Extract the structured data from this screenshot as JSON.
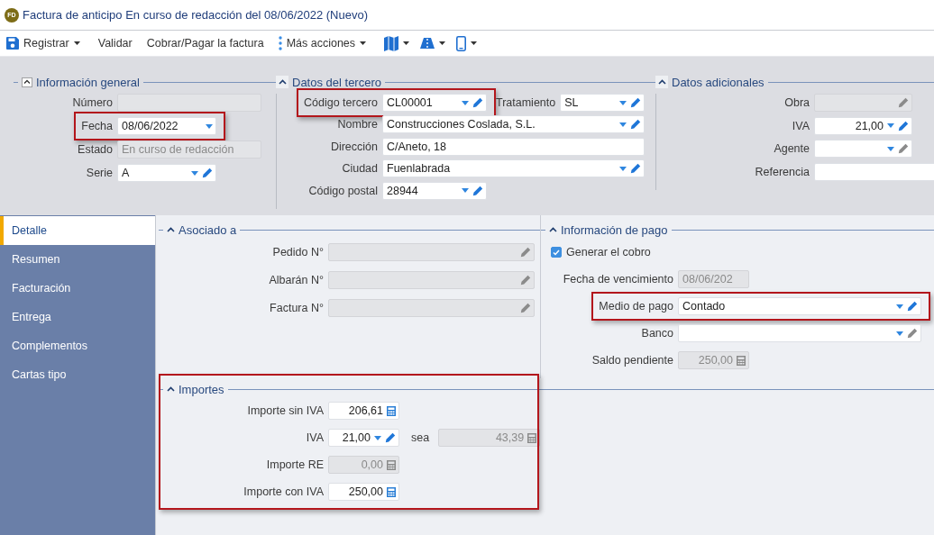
{
  "window": {
    "badge": "FD",
    "title": "Factura de anticipo En curso de redacción del 08/06/2022 (Nuevo)"
  },
  "toolbar": [
    {
      "kind": "save",
      "label": "Registrar",
      "menu": true
    },
    {
      "kind": "plain",
      "label": "Validar",
      "menu": false
    },
    {
      "kind": "plain",
      "label": "Cobrar/Pagar la factura",
      "menu": false
    },
    {
      "kind": "more",
      "label": "Más acciones",
      "menu": true
    },
    {
      "kind": "map",
      "menu": true
    },
    {
      "kind": "road",
      "menu": true
    },
    {
      "kind": "phone",
      "menu": true
    }
  ],
  "header_sections": [
    {
      "title": "Información general",
      "kind": "box",
      "fields": [
        {
          "label": "Número",
          "kind": "text",
          "disabled": true,
          "highlighted": false
        },
        {
          "label": "Fecha",
          "value": "08/06/2022",
          "kind": "date",
          "disabled": false,
          "highlighted": true
        },
        {
          "label": "Estado",
          "value": "En curso de redacción",
          "kind": "text",
          "disabled": true,
          "highlighted": false
        },
        {
          "label": "Serie",
          "value": "A",
          "kind": "lookup",
          "disabled": false,
          "highlighted": false,
          "edit": true
        }
      ]
    },
    {
      "title": "Datos del tercero",
      "kind": "caret",
      "fields": [
        {
          "label": "Código tercero",
          "value": "CL00001",
          "kind": "lookup",
          "disabled": false,
          "highlighted": true,
          "edit": true,
          "extra": {
            "label": "Tratamiento",
            "value": "SL",
            "kind": "lookup",
            "disabled": false,
            "edit": true
          }
        },
        {
          "label": "Nombre",
          "value": "Construcciones Coslada, S.L.",
          "kind": "lookup",
          "disabled": false,
          "highlighted": false,
          "edit": true
        },
        {
          "label": "Dirección",
          "value": "C/Aneto, 18",
          "kind": "text",
          "disabled": false,
          "highlighted": false
        },
        {
          "label": "Ciudad",
          "value": "Fuenlabrada",
          "kind": "lookup",
          "disabled": false,
          "highlighted": false,
          "edit": true
        },
        {
          "label": "Código postal",
          "value": "28944",
          "kind": "lookup",
          "disabled": false,
          "highlighted": false,
          "edit": true
        }
      ]
    },
    {
      "title": "Datos adicionales",
      "kind": "caret",
      "fields": [
        {
          "label": "Obra",
          "kind": "link",
          "disabled": true,
          "highlighted": false
        },
        {
          "label": "IVA",
          "value": "21,00",
          "kind": "lookup",
          "numeric": true,
          "disabled": false,
          "highlighted": false,
          "edit": true
        },
        {
          "label": "Agente",
          "kind": "lookup",
          "disabled": false,
          "highlighted": false,
          "edit": false
        },
        {
          "label": "Referencia",
          "kind": "text",
          "disabled": false,
          "highlighted": false
        }
      ]
    }
  ],
  "tabs": [
    {
      "label": "Detalle",
      "selected": true
    },
    {
      "label": "Resumen",
      "selected": false
    },
    {
      "label": "Facturación",
      "selected": false
    },
    {
      "label": "Entrega",
      "selected": false
    },
    {
      "label": "Complementos",
      "selected": false
    },
    {
      "label": "Cartas tipo",
      "selected": false
    }
  ],
  "detail_sections": [
    {
      "title": "Asociado a",
      "kind": "caret",
      "fields": [
        {
          "label": "Pedido N°",
          "kind": "link",
          "disabled": true,
          "highlighted": false
        },
        {
          "label": "Albarán N°",
          "kind": "link",
          "disabled": true,
          "highlighted": false
        },
        {
          "label": "Factura N°",
          "kind": "link",
          "disabled": true,
          "highlighted": false
        }
      ]
    },
    {
      "title": "Información de pago",
      "kind": "caret",
      "fields": [
        {
          "label": "Generar el cobro",
          "kind": "checkbox",
          "checked": true
        },
        {
          "label": "Fecha de vencimiento",
          "value": "08/06/202",
          "kind": "text",
          "disabled": true,
          "highlighted": false
        },
        {
          "label": "Medio de pago",
          "value": "Contado",
          "kind": "lookup",
          "disabled": false,
          "highlighted": true,
          "edit": true
        },
        {
          "label": "Banco",
          "kind": "lookup",
          "disabled": false,
          "highlighted": false,
          "edit": false
        },
        {
          "label": "Saldo pendiente",
          "value": "250,00",
          "kind": "amount",
          "disabled": true,
          "highlighted": false
        }
      ]
    }
  ],
  "amounts": {
    "title": "Importes",
    "kind": "caret",
    "highlighted": true,
    "fields": [
      {
        "label": "Importe sin IVA",
        "value": "206,61",
        "kind": "amount",
        "disabled": false,
        "highlighted": false
      },
      {
        "label": "IVA",
        "value": "21,00",
        "kind": "lookup",
        "numeric": true,
        "disabled": false,
        "highlighted": false,
        "edit": true,
        "extra": {
          "label": "sea",
          "value": "43,39",
          "kind": "amount",
          "disabled": true
        }
      },
      {
        "label": "Importe RE",
        "value": "0,00",
        "kind": "amount",
        "disabled": true,
        "highlighted": false
      },
      {
        "label": "Importe con IVA",
        "value": "250,00",
        "kind": "amount",
        "disabled": false,
        "highlighted": false
      }
    ]
  }
}
